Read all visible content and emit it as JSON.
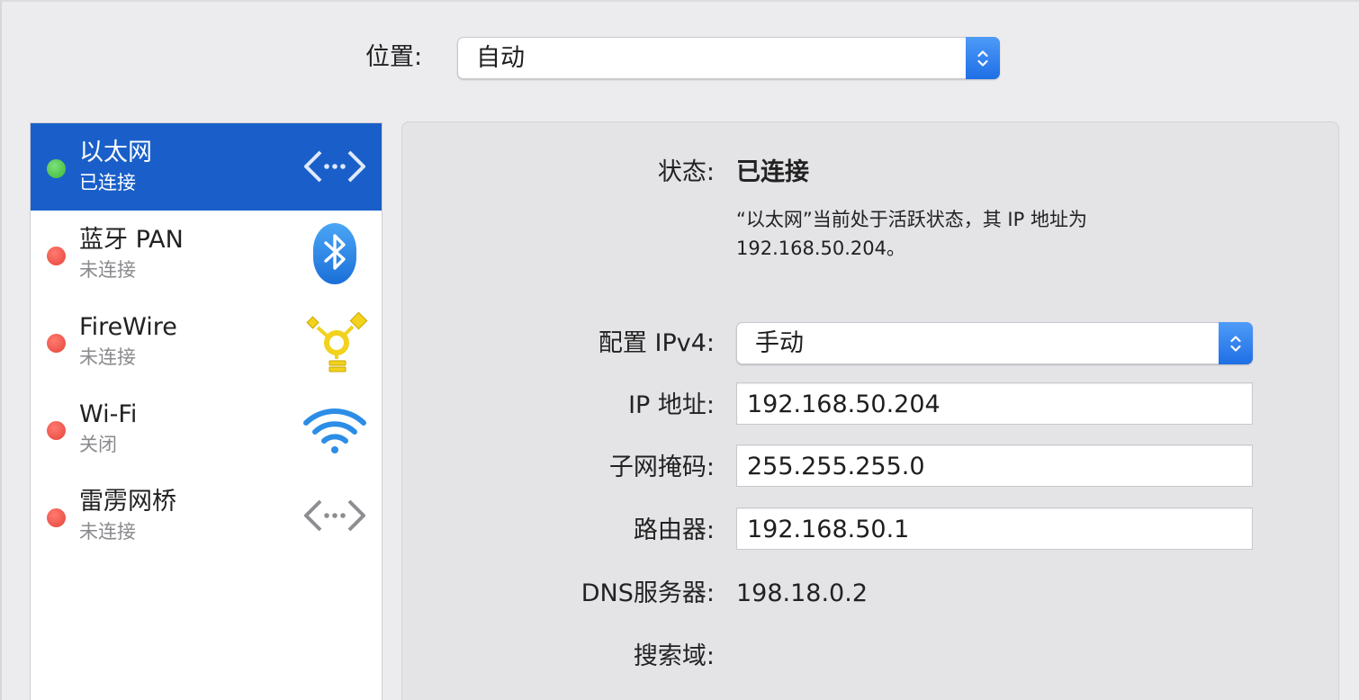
{
  "location": {
    "label": "位置:",
    "value": "自动"
  },
  "services": [
    {
      "name": "以太网",
      "status": "已连接",
      "connected": true,
      "selected": true,
      "icon": "ethernet-icon"
    },
    {
      "name": "蓝牙 PAN",
      "status": "未连接",
      "connected": false,
      "selected": false,
      "icon": "bluetooth-icon"
    },
    {
      "name": "FireWire",
      "status": "未连接",
      "connected": false,
      "selected": false,
      "icon": "firewire-icon"
    },
    {
      "name": "Wi-Fi",
      "status": "关闭",
      "connected": false,
      "selected": false,
      "icon": "wifi-icon"
    },
    {
      "name": "雷雳网桥",
      "status": "未连接",
      "connected": false,
      "selected": false,
      "icon": "thunderbolt-bridge-icon"
    }
  ],
  "detail": {
    "status_label": "状态:",
    "status_value": "已连接",
    "description_line1": "“以太网”当前处于活跃状态，其 IP 地址为",
    "description_line2": "192.168.50.204。",
    "config_label": "配置 IPv4:",
    "config_value": "手动",
    "ip_label": "IP 地址:",
    "ip_value": "192.168.50.204",
    "subnet_label": "子网掩码:",
    "subnet_value": "255.255.255.0",
    "router_label": "路由器:",
    "router_value": "192.168.50.1",
    "dns_label": "DNS服务器:",
    "dns_value": "198.18.0.2",
    "search_label": "搜索域:"
  },
  "colors": {
    "selection": "#1a5fc9",
    "stepper": "#2a7ef0",
    "connected_dot": "#3cb836",
    "disconnected_dot": "#e5453b",
    "window_bg": "#ecebed"
  }
}
